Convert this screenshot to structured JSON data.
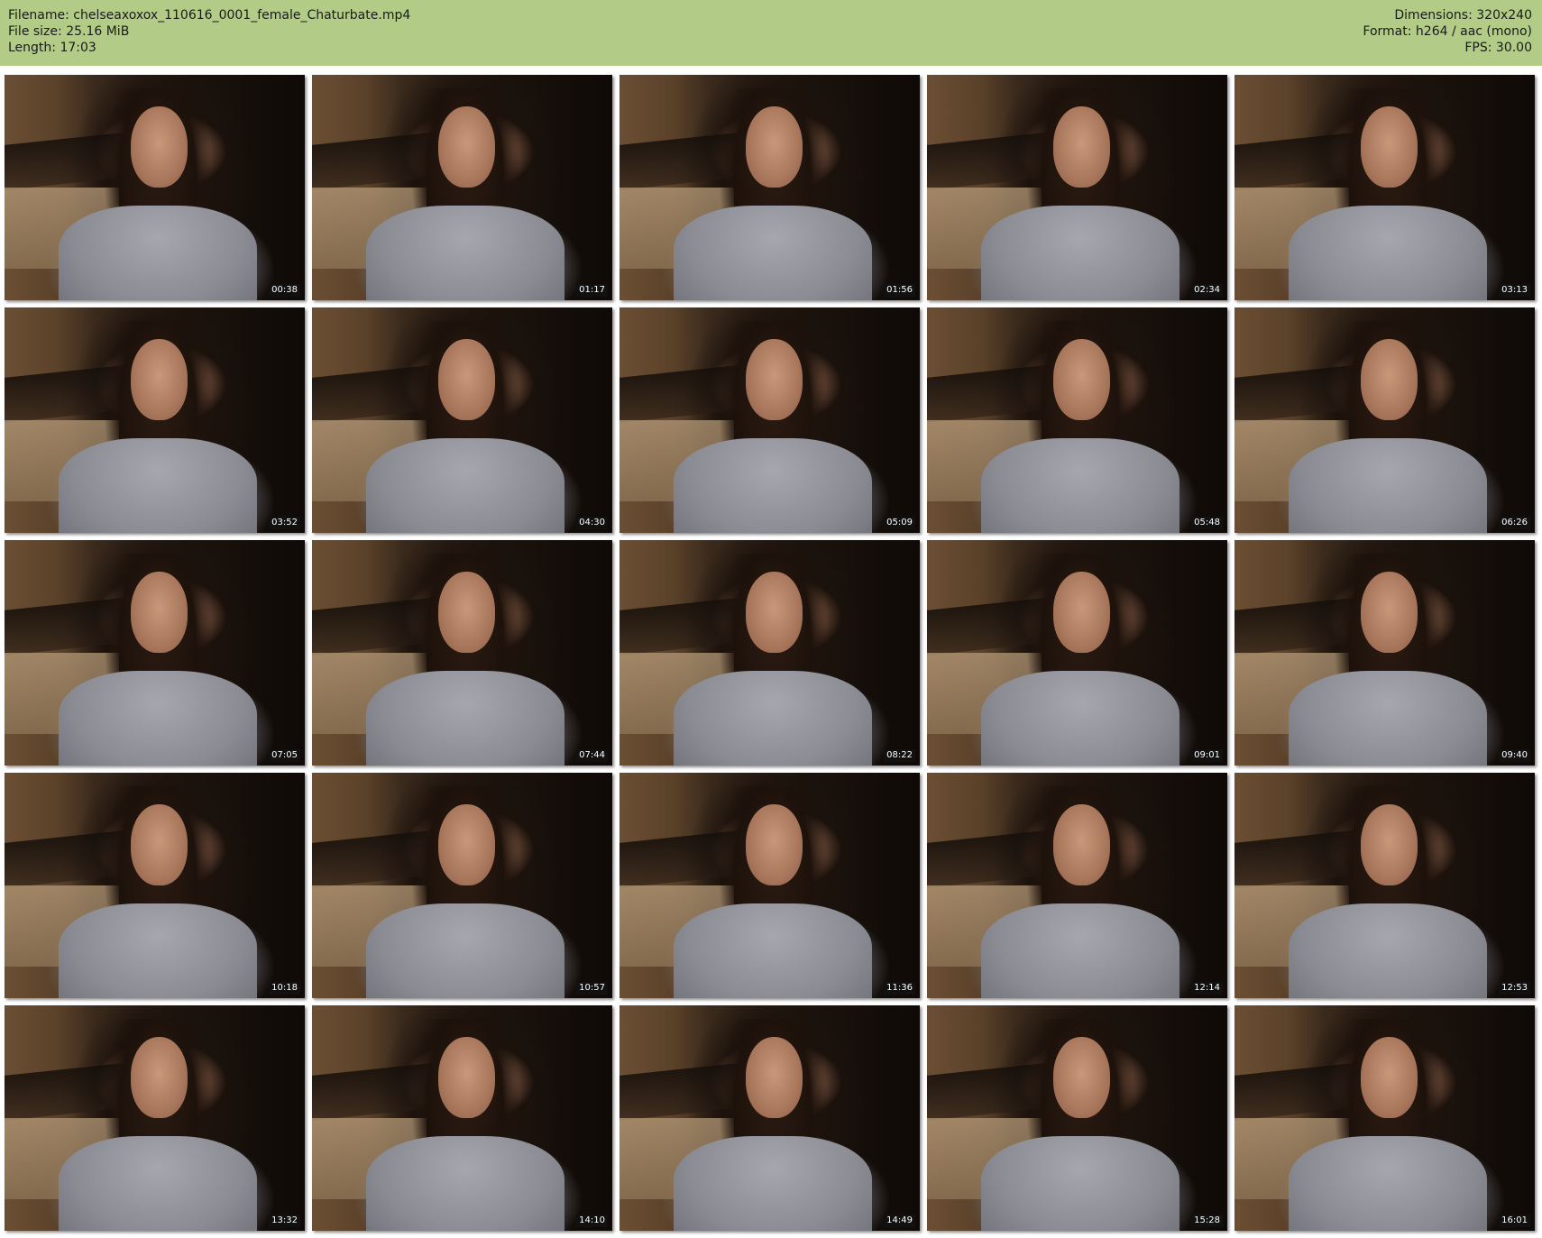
{
  "header": {
    "filename_line": "Filename: chelseaxoxox_110616_0001_female_Chaturbate.mp4",
    "filesize_line": "File size: 25.16 MiB",
    "length_line": "Length: 17:03",
    "dimensions_line": "Dimensions: 320x240",
    "format_line": "Format: h264 / aac (mono)",
    "fps_line": "FPS: 30.00"
  },
  "colors": {
    "header_background": "#b2cc88",
    "timestamp_background": "#111111"
  },
  "thumbnails": [
    {
      "time": "00:38"
    },
    {
      "time": "01:17"
    },
    {
      "time": "01:56"
    },
    {
      "time": "02:34"
    },
    {
      "time": "03:13"
    },
    {
      "time": "03:52"
    },
    {
      "time": "04:30"
    },
    {
      "time": "05:09"
    },
    {
      "time": "05:48"
    },
    {
      "time": "06:26"
    },
    {
      "time": "07:05"
    },
    {
      "time": "07:44"
    },
    {
      "time": "08:22"
    },
    {
      "time": "09:01"
    },
    {
      "time": "09:40"
    },
    {
      "time": "10:18"
    },
    {
      "time": "10:57"
    },
    {
      "time": "11:36"
    },
    {
      "time": "12:14"
    },
    {
      "time": "12:53"
    },
    {
      "time": "13:32"
    },
    {
      "time": "14:10"
    },
    {
      "time": "14:49"
    },
    {
      "time": "15:28"
    },
    {
      "time": "16:01"
    }
  ]
}
